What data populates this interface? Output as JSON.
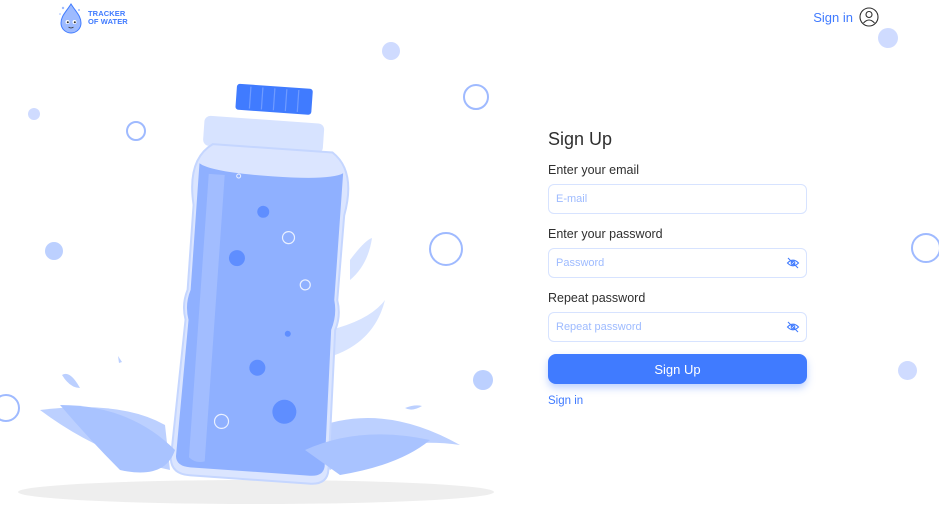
{
  "header": {
    "logo_line1": "TRACKER",
    "logo_line2": "OF WATER",
    "signin_label": "Sign in"
  },
  "form": {
    "title": "Sign Up",
    "email_label": "Enter your email",
    "email_placeholder": "E-mail",
    "email_value": "",
    "password_label": "Enter your password",
    "password_placeholder": "Password",
    "password_value": "",
    "repeat_label": "Repeat password",
    "repeat_placeholder": "Repeat password",
    "repeat_value": "",
    "submit_label": "Sign Up",
    "signin_link": "Sign in"
  },
  "icons": {
    "user": "user-circle-icon",
    "eye": "eye-slash-icon"
  },
  "colors": {
    "accent": "#407bff",
    "input_border": "#d7e3ff",
    "placeholder": "#9ebbff",
    "bubble": "#cfdbff"
  }
}
